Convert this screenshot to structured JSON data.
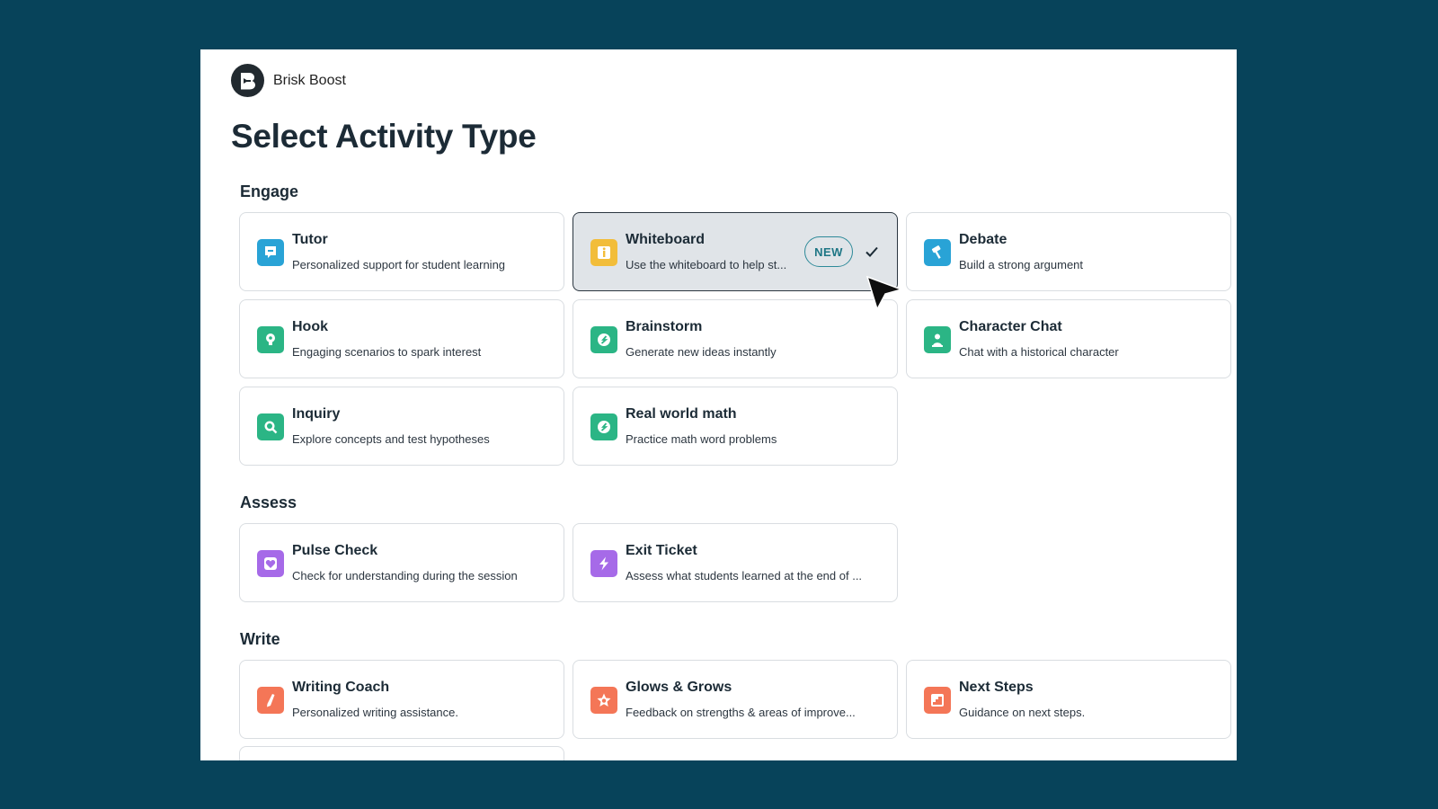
{
  "app": {
    "name": "Brisk Boost"
  },
  "page": {
    "title": "Select Activity Type"
  },
  "sections": [
    {
      "title": "Engage",
      "cards": [
        {
          "title": "Tutor",
          "desc": "Personalized support for student learning",
          "icon": "chat-icon",
          "color": "#29a3d6"
        },
        {
          "title": "Whiteboard",
          "desc": "Use the whiteboard to help st...",
          "icon": "info-icon",
          "color": "#f2bd3a",
          "badge": "NEW",
          "selected": true
        },
        {
          "title": "Debate",
          "desc": "Build a strong argument",
          "icon": "gavel-icon",
          "color": "#29a3d6"
        },
        {
          "title": "Hook",
          "desc": "Engaging scenarios to spark interest",
          "icon": "lightbulb-icon",
          "color": "#2bb585"
        },
        {
          "title": "Brainstorm",
          "desc": "Generate new ideas instantly",
          "icon": "compass-icon",
          "color": "#2bb585"
        },
        {
          "title": "Character Chat",
          "desc": "Chat with a historical character",
          "icon": "person-icon",
          "color": "#2bb585"
        },
        {
          "title": "Inquiry",
          "desc": "Explore concepts and test hypotheses",
          "icon": "magnifier-icon",
          "color": "#2bb585"
        },
        {
          "title": "Real world math",
          "desc": "Practice math word problems",
          "icon": "compass-icon",
          "color": "#2bb585"
        }
      ]
    },
    {
      "title": "Assess",
      "cards": [
        {
          "title": "Pulse Check",
          "desc": "Check for understanding during the session",
          "icon": "heart-icon",
          "color": "#a66ae8"
        },
        {
          "title": "Exit Ticket",
          "desc": "Assess what students learned at the end of ...",
          "icon": "lightning-icon",
          "color": "#a66ae8"
        }
      ]
    },
    {
      "title": "Write",
      "cards": [
        {
          "title": "Writing Coach",
          "desc": "Personalized writing assistance.",
          "icon": "pen-icon",
          "color": "#f47657"
        },
        {
          "title": "Glows & Grows",
          "desc": "Feedback on strengths & areas of improve...",
          "icon": "star-icon",
          "color": "#f47657"
        },
        {
          "title": "Next Steps",
          "desc": "Guidance on next steps.",
          "icon": "stairs-icon",
          "color": "#f47657"
        }
      ]
    }
  ]
}
